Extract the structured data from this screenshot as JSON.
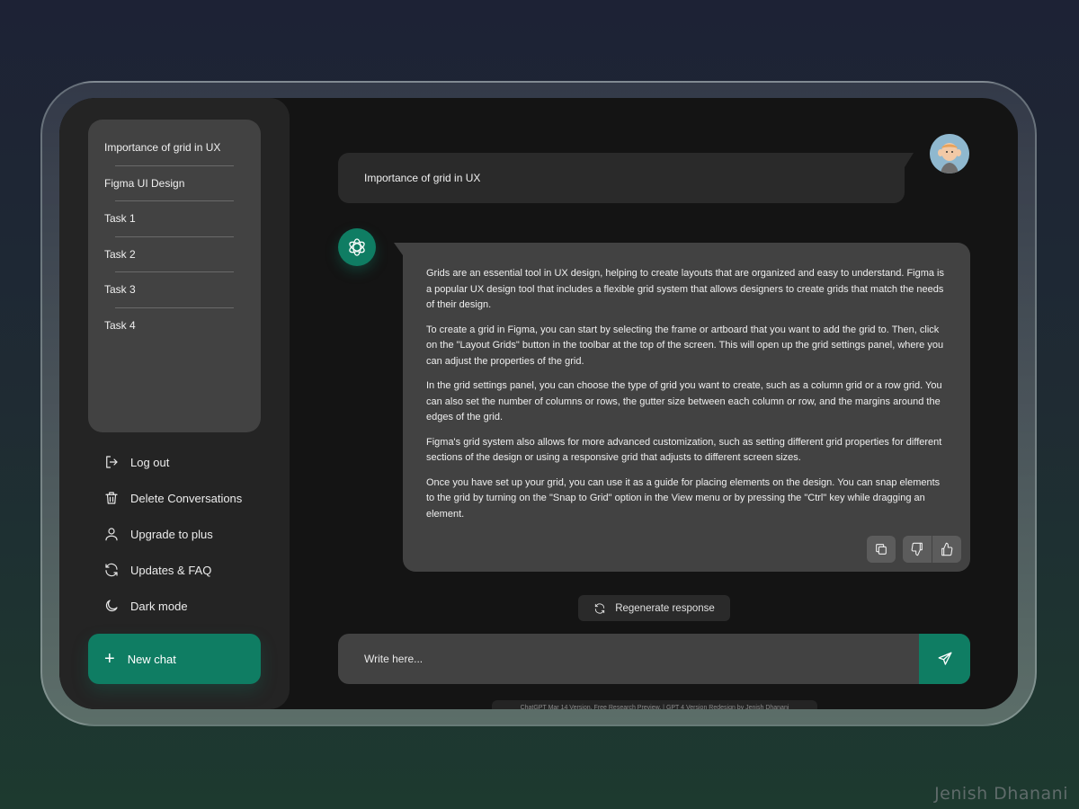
{
  "sidebar": {
    "history": [
      {
        "label": "Importance of grid in UX"
      },
      {
        "label": "Figma UI Design"
      },
      {
        "label": "Task 1"
      },
      {
        "label": "Task 2"
      },
      {
        "label": "Task 3"
      },
      {
        "label": "Task 4"
      }
    ],
    "menu": [
      {
        "label": "Log out",
        "icon": "logout-icon"
      },
      {
        "label": "Delete Conversations",
        "icon": "trash-icon"
      },
      {
        "label": "Upgrade to plus",
        "icon": "user-icon"
      },
      {
        "label": "Updates & FAQ",
        "icon": "refresh-icon"
      },
      {
        "label": "Dark mode",
        "icon": "moon-icon"
      }
    ],
    "new_chat_label": "New chat"
  },
  "chat": {
    "user_message": "Importance of grid in UX",
    "bot_paragraphs": [
      "Grids are an essential tool in UX design, helping to create layouts that are organized and easy to understand. Figma is a popular UX design tool that includes a flexible grid system that allows designers to create grids that match the needs of their design.",
      "To create a grid in Figma, you can start by selecting the frame or artboard that you want to add the grid to. Then, click on the \"Layout Grids\" button in the toolbar at the top of the screen. This will open up the grid settings panel, where you can adjust the properties of the grid.",
      "In the grid settings panel, you can choose the type of grid you want to create, such as a column grid or a row grid. You can also set the number of columns or rows, the gutter size between each column or row, and the margins around the edges of the grid.",
      "Figma's grid system also allows for more advanced customization, such as setting different grid properties for different sections of the design or using a responsive grid that adjusts to different screen sizes.",
      "Once you have set up your grid, you can use it as a guide for placing elements on the design. You can snap elements to the grid by turning on the \"Snap to Grid\" option in the View menu or by pressing the \"Ctrl\" key while dragging an element."
    ],
    "regenerate_label": "Regenerate response",
    "input_placeholder": "Write here...",
    "footer_note": "ChatGPT Mar 14 Version. Free Research Preview. | GPT 4 Version Redesign by Jenish Dhanani"
  },
  "watermark": "Jenish Dhanani",
  "colors": {
    "accent": "#0f7d63",
    "screen_bg": "#141414",
    "panel": "#242424",
    "card": "#424242"
  }
}
